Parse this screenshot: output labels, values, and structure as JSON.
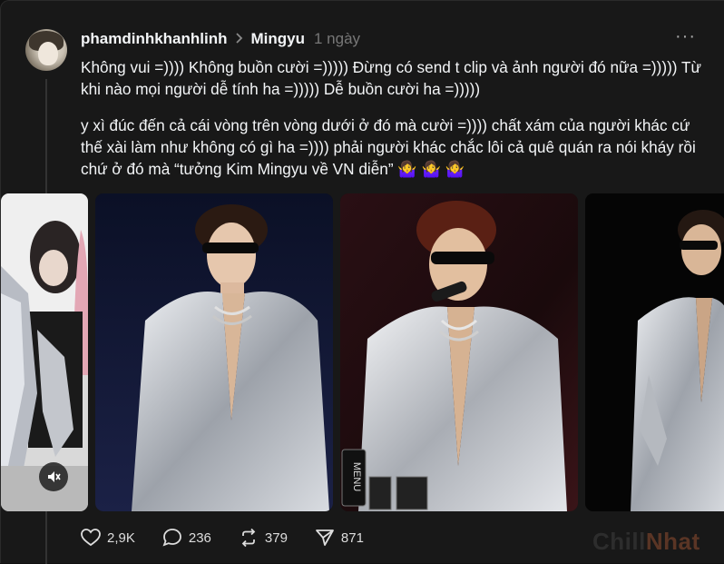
{
  "post": {
    "username": "phamdinhkhanhlinh",
    "topic": "Mingyu",
    "time": "1 ngày",
    "more": "···",
    "paragraph1": "Không vui =)))) Không buồn cười =))))) Đừng có send t clip và ảnh người đó nữa =))))) Từ khi nào mọi người dễ tính ha =))))) Dễ buồn cười ha =)))))",
    "paragraph2": "y xì đúc đến cả cái vòng trên vòng dưới ở đó mà cười =)))) chất xám của người khác cứ thế xài làm như không có gì ha =)))) phải người khác chắc lôi cả quê quán ra nói kháy rồi chứ ở đó mà “tưởng Kim Mingyu về VN diễn” 🤷‍♀️ 🤷‍♀️ 🤷‍♀️"
  },
  "media": {
    "items": [
      {
        "name": "video-thumbnail-1",
        "label": ""
      },
      {
        "name": "photo-2",
        "label": ""
      },
      {
        "name": "photo-3",
        "label": "MENU"
      },
      {
        "name": "photo-4",
        "label": ""
      }
    ],
    "mute_icon": "speaker-muted-icon"
  },
  "actions": {
    "likes": "2,9K",
    "comments": "236",
    "reposts": "379",
    "shares": "871"
  },
  "watermark": {
    "part1": "Chill",
    "part2": "Nhat"
  },
  "colors": {
    "background": "#181818",
    "text": "#f3f5f7",
    "muted": "#777777",
    "suit": "#c8ccd2"
  }
}
